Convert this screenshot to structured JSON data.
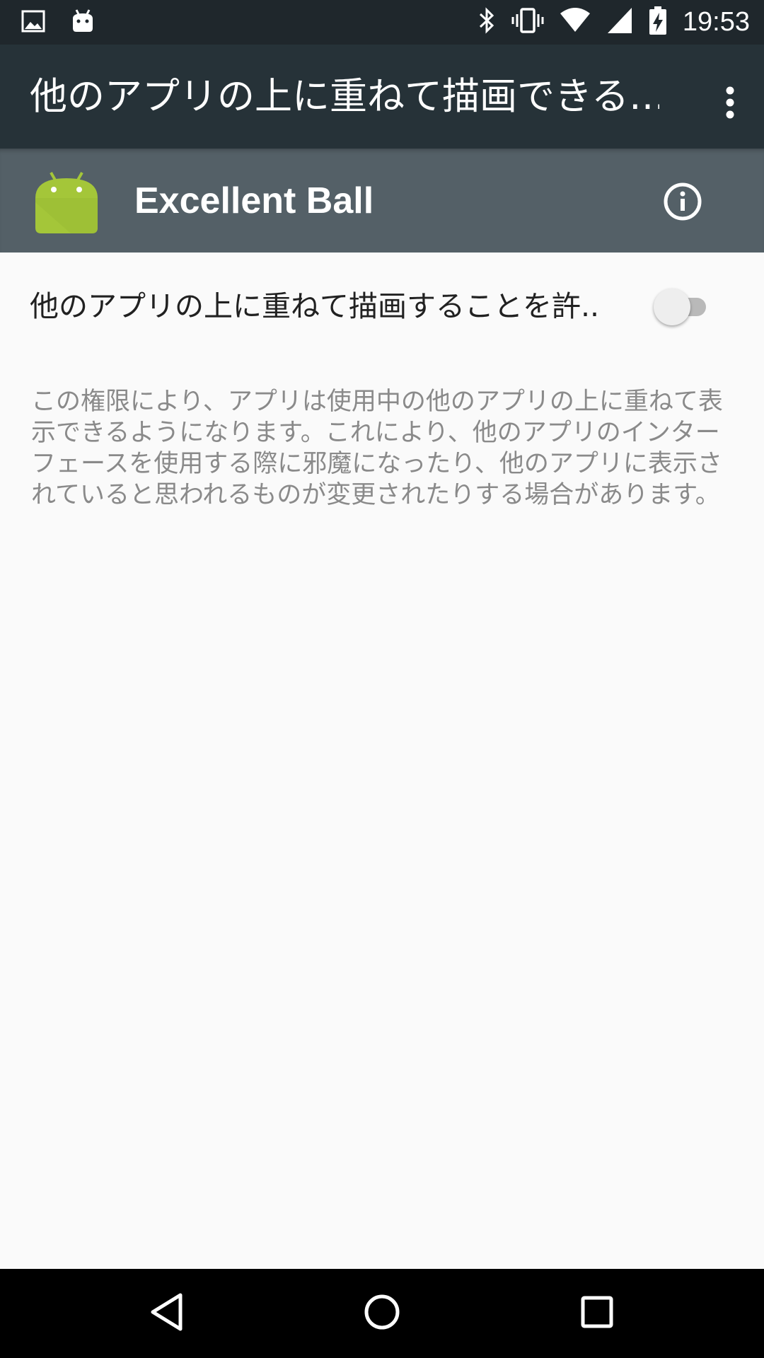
{
  "status_bar": {
    "time": "19:53",
    "left_icons": [
      "image-notification-icon",
      "android-notification-icon"
    ],
    "right_icons": [
      "bluetooth-icon",
      "vibrate-icon",
      "wifi-icon",
      "cell-signal-icon",
      "battery-charging-icon"
    ]
  },
  "app_bar": {
    "title": "他のアプリの上に重ねて描画できる…",
    "overflow_icon": "more-vert-icon"
  },
  "app_header": {
    "app_name": "Excellent Ball",
    "app_icon": "android-icon",
    "info_icon": "info-icon"
  },
  "preference": {
    "label": "他のアプリの上に重ねて描画することを許..",
    "switch_on": false
  },
  "description": "この権限により、アプリは使用中の他のアプリの上に重ねて表示できるようになります。これにより、他のアプリのインターフェースを使用する際に邪魔になったり、他のアプリに表示されていると思われるものが変更されたりする場合があります。",
  "nav_bar": {
    "buttons": [
      "back-icon",
      "home-icon",
      "recents-icon"
    ]
  },
  "colors": {
    "status_bar": "#1f272c",
    "app_bar": "#263238",
    "app_header": "#546067",
    "background": "#fafafa",
    "android_green": "#a4c639"
  }
}
